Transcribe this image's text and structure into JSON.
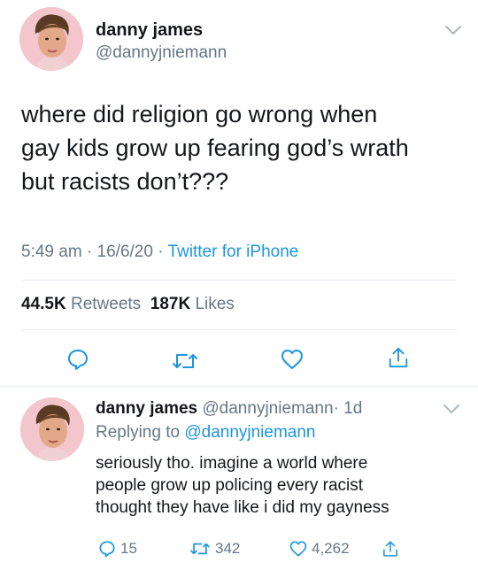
{
  "tweet": {
    "author_name": "danny james",
    "author_handle": "@dannyjniemann",
    "text_lines": [
      "where did religion go wrong when",
      "gay kids grow up fearing god’s wrath",
      "but racists don’t???"
    ],
    "time": "5:49 am",
    "date": "16/6/20",
    "separator": "·",
    "source": "Twitter for iPhone",
    "retweets_count": "44.5K",
    "retweets_label": "Retweets",
    "likes_count": "187K",
    "likes_label": "Likes"
  },
  "reply": {
    "author_name": "danny james",
    "author_handle": "@dannyjniemann",
    "age": "1d",
    "replying_prefix": "Replying to",
    "replying_to": "@dannyjniemann",
    "text_lines": [
      "seriously tho. imagine a world where",
      "people grow up policing every racist",
      "thought they have like i did my gayness"
    ],
    "reply_count": "15",
    "retweet_count": "342",
    "like_count": "4,262"
  },
  "icons": {
    "chevron": "chevron-down-icon",
    "reply": "reply-icon",
    "retweet": "retweet-icon",
    "like": "heart-icon",
    "share": "share-icon"
  },
  "colors": {
    "text": "#14171a",
    "secondary": "#657786",
    "link": "#1b95e0",
    "divider": "#e6ecf0"
  }
}
